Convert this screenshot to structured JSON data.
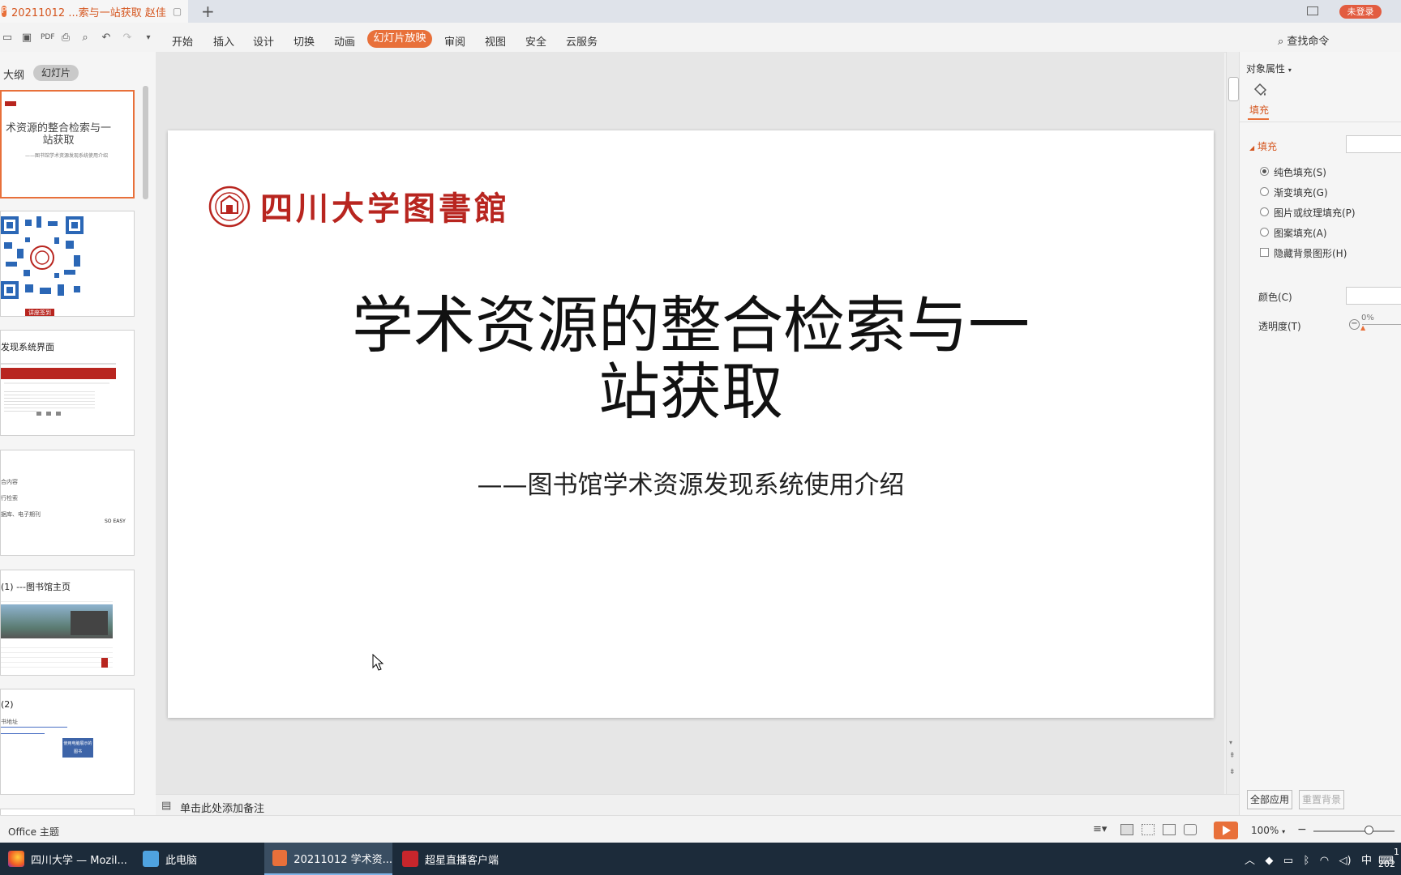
{
  "titlebar": {
    "doc_tab": "20211012 ...索与一站获取  赵佳",
    "login": "未登录"
  },
  "menubar": {
    "items": [
      "开始",
      "插入",
      "设计",
      "切换",
      "动画",
      "幻灯片放映",
      "审阅",
      "视图",
      "安全",
      "云服务"
    ],
    "find_command": "查找命令"
  },
  "left_panel": {
    "tabs": [
      "大纲",
      "幻灯片"
    ],
    "thumbs": [
      {
        "title": "术资源的整合检索与一站获取",
        "sub": "——图书馆学术资源发现系统使用介绍"
      },
      {
        "badge": "讲座签到"
      },
      {
        "title": "发现系统界面"
      },
      {
        "lines": [
          "合内容",
          "行检索",
          "据库、电子期刊"
        ],
        "tag": "SO EASY"
      },
      {
        "title": "(1)  ---图书馆主页"
      },
      {
        "title": "(2)",
        "lines": [
          "书地址"
        ],
        "button": "使用电脑展示的图书"
      }
    ]
  },
  "slide": {
    "logo_text": "四川大学图書館",
    "title_line1": "学术资源的整合检索与一",
    "title_line2": "站获取",
    "subtitle": "——图书馆学术资源发现系统使用介绍"
  },
  "notes": {
    "placeholder": "单击此处添加备注"
  },
  "right_panel": {
    "header": "对象属性",
    "tab_fill": "填充",
    "section_fill": "填充",
    "options": [
      "纯色填充(S)",
      "渐变填充(G)",
      "图片或纹理填充(P)",
      "图案填充(A)"
    ],
    "hide_bg": "隐藏背景图形(H)",
    "color_label": "颜色(C)",
    "transparency_label": "透明度(T)",
    "transparency_value": "0%",
    "apply_all": "全部应用",
    "reset_bg": "重置背景"
  },
  "statusbar": {
    "theme": "Office 主题",
    "zoom": "100%"
  },
  "taskbar": {
    "tasks": [
      "四川大学 — Mozil...",
      "此电脑",
      "20211012 学术资...",
      "超星直播客户端"
    ],
    "ime": "中",
    "clock_line1": "1",
    "clock_line2": "202"
  },
  "colors": {
    "accent": "#e8703a",
    "logo_red": "#b8251f",
    "taskbar": "#1c2b3a"
  }
}
